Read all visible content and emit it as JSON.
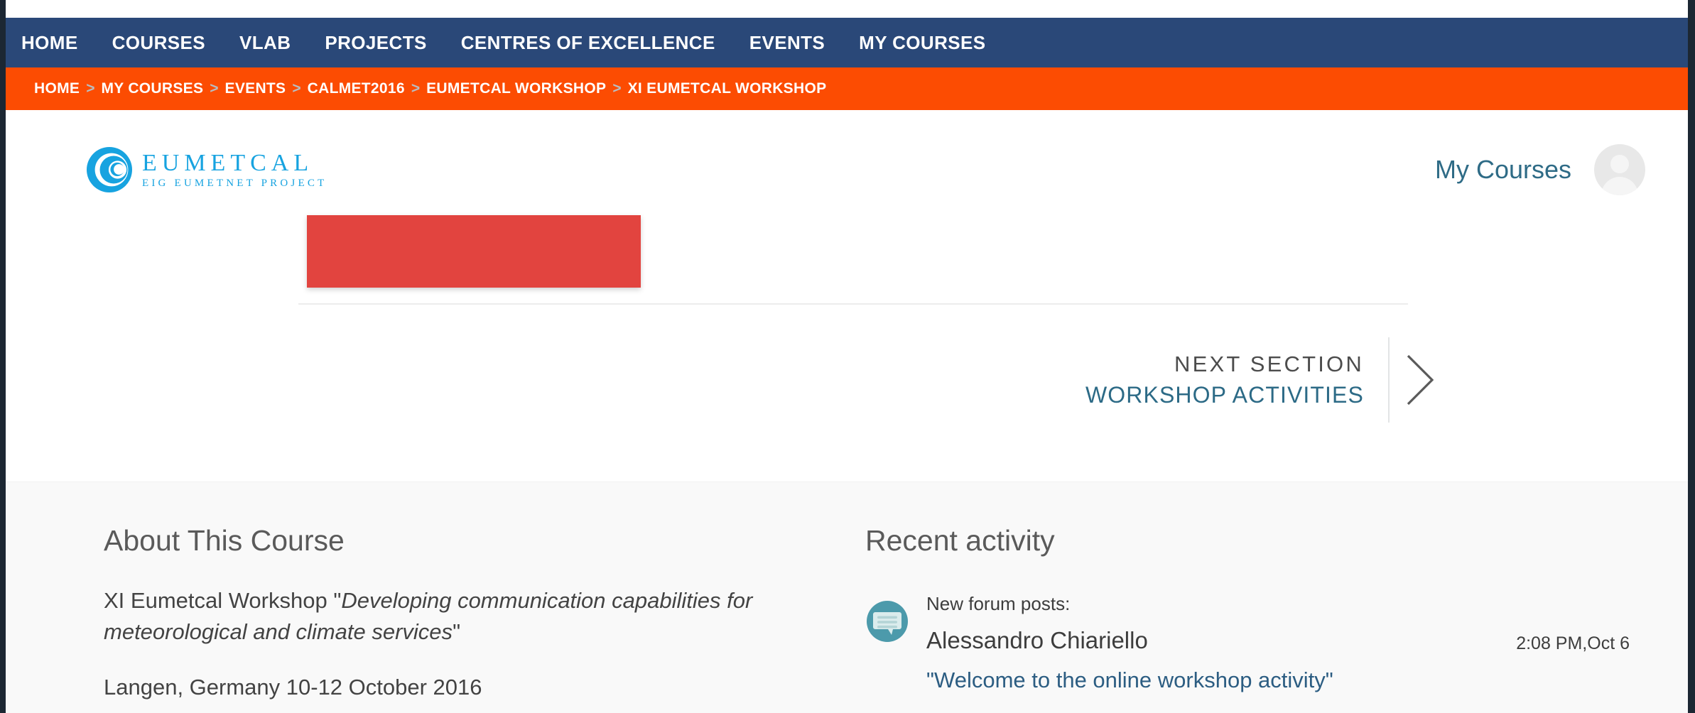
{
  "topnav": {
    "items": [
      {
        "label": "HOME"
      },
      {
        "label": "COURSES"
      },
      {
        "label": "VLAB"
      },
      {
        "label": "PROJECTS"
      },
      {
        "label": "CENTRES OF EXCELLENCE"
      },
      {
        "label": "EVENTS"
      },
      {
        "label": "MY COURSES"
      }
    ]
  },
  "breadcrumb": {
    "separator": ">",
    "items": [
      {
        "label": "HOME"
      },
      {
        "label": "MY COURSES"
      },
      {
        "label": "EVENTS"
      },
      {
        "label": "CALMET2016"
      },
      {
        "label": "EUMETCAL WORKSHOP"
      },
      {
        "label": "XI EUMETCAL WORKSHOP"
      }
    ]
  },
  "header": {
    "logo_title": "EUMETCAL",
    "logo_subtitle": "EIG EUMETNET PROJECT",
    "logo_icon": "eumetcal-crescent-logo",
    "my_courses_label": "My Courses",
    "avatar_icon": "user-avatar-placeholder-icon"
  },
  "main": {
    "red_block_color": "#e2443f",
    "next_section": {
      "kicker": "NEXT SECTION",
      "title": "WORKSHOP ACTIVITIES",
      "arrow_icon": "chevron-right-icon"
    }
  },
  "about": {
    "heading": "About This Course",
    "paragraph_lead": "XI Eumetcal Workshop \"",
    "paragraph_italic": "Developing communication capabilities for meteorological and climate services",
    "paragraph_tail": "\"",
    "line2": "Langen, Germany 10-12 October 2016"
  },
  "recent_activity": {
    "heading": "Recent activity",
    "items": [
      {
        "icon": "forum-speech-bubble-icon",
        "kicker": "New forum posts:",
        "author": "Alessandro Chiariello",
        "link": "\"Welcome to the online workshop activity\"",
        "time": "2:08 PM,Oct 6"
      }
    ]
  },
  "colors": {
    "navbar": "#2a4878",
    "breadcrumb": "#fc4c02",
    "brand": "#17a3e0",
    "link": "#2c6a86",
    "accent_red": "#e2443f",
    "bubble_teal": "#4c9aab"
  }
}
